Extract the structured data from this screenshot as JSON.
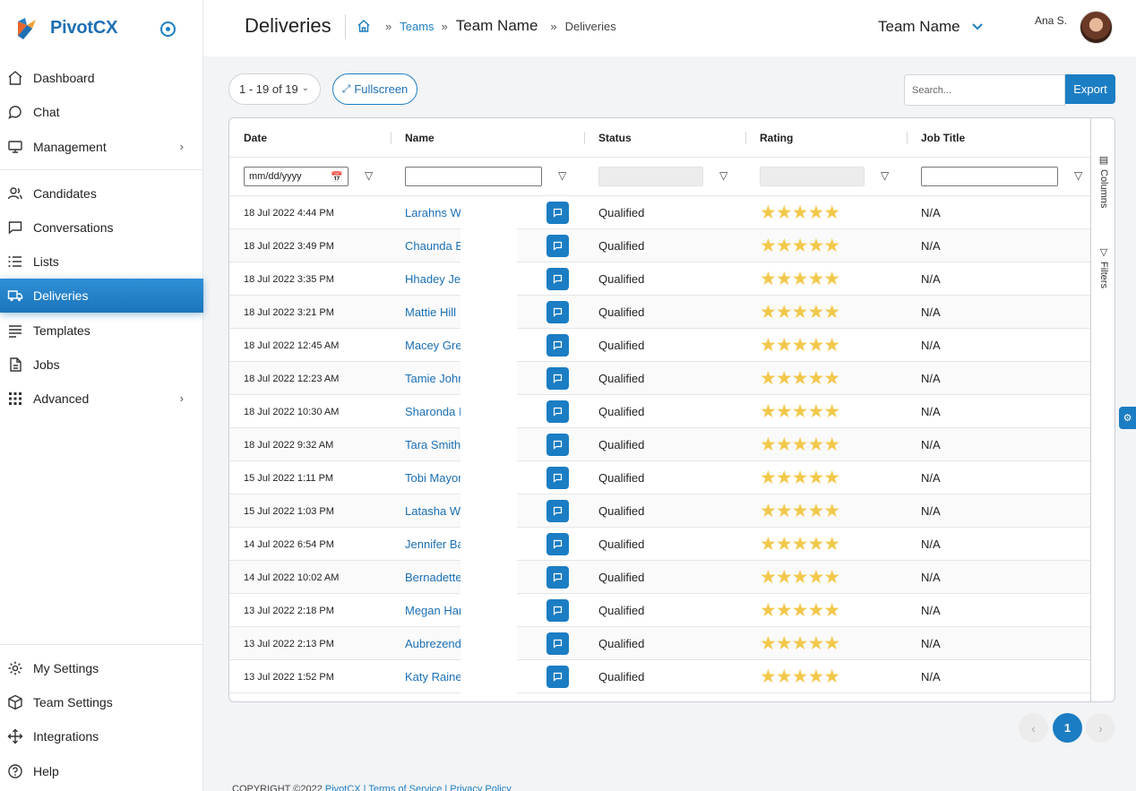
{
  "brand": {
    "name": "PivotCX"
  },
  "sidebar": {
    "main_items": [
      {
        "label": "Dashboard",
        "icon": "home-icon"
      },
      {
        "label": "Chat",
        "icon": "chat-bubble-icon"
      },
      {
        "label": "Management",
        "icon": "monitor-icon",
        "has_children": true
      }
    ],
    "work_items": [
      {
        "label": "Candidates",
        "icon": "users-icon"
      },
      {
        "label": "Conversations",
        "icon": "message-square-icon"
      },
      {
        "label": "Lists",
        "icon": "list-icon"
      },
      {
        "label": "Deliveries",
        "icon": "truck-icon",
        "active": true
      },
      {
        "label": "Templates",
        "icon": "align-left-icon"
      },
      {
        "label": "Jobs",
        "icon": "document-icon"
      },
      {
        "label": "Advanced",
        "icon": "grid-icon",
        "has_children": true
      }
    ],
    "bottom_items": [
      {
        "label": "My Settings",
        "icon": "gear-icon"
      },
      {
        "label": "Team Settings",
        "icon": "box-icon"
      },
      {
        "label": "Integrations",
        "icon": "move-icon"
      },
      {
        "label": "Help",
        "icon": "help-circle-icon"
      }
    ]
  },
  "header": {
    "title": "Deliveries",
    "breadcrumb": {
      "teams": "Teams",
      "team_name": "Team Name",
      "current": "Deliveries"
    },
    "team_select": "Team Name",
    "user_name": "Ana S."
  },
  "toolbar": {
    "pager_label": "1 - 19 of 19",
    "fullscreen_label": "Fullscreen",
    "search_placeholder": "Search...",
    "export_label": "Export"
  },
  "grid": {
    "columns": [
      "Date",
      "Name",
      "Status",
      "Rating",
      "Job Title"
    ],
    "date_filter_placeholder": "mm/dd/yyyy",
    "rows": [
      {
        "date": "18 Jul 2022 4:44 PM",
        "name": "Larahns W",
        "status": "Qualified",
        "rating": 5,
        "job_title": "N/A"
      },
      {
        "date": "18 Jul 2022 3:49 PM",
        "name": "Chaunda B",
        "status": "Qualified",
        "rating": 5,
        "job_title": "N/A"
      },
      {
        "date": "18 Jul 2022 3:35 PM",
        "name": "Hhadey Je",
        "status": "Qualified",
        "rating": 5,
        "job_title": "N/A"
      },
      {
        "date": "18 Jul 2022 3:21 PM",
        "name": "Mattie Hill",
        "status": "Qualified",
        "rating": 5,
        "job_title": "N/A"
      },
      {
        "date": "18 Jul 2022 12:45 AM",
        "name": "Macey Gre",
        "status": "Qualified",
        "rating": 5,
        "job_title": "N/A"
      },
      {
        "date": "18 Jul 2022 12:23 AM",
        "name": "Tamie Johr",
        "status": "Qualified",
        "rating": 5,
        "job_title": "N/A"
      },
      {
        "date": "18 Jul 2022 10:30 AM",
        "name": "Sharonda I",
        "status": "Qualified",
        "rating": 5,
        "job_title": "N/A"
      },
      {
        "date": "18 Jul 2022 9:32 AM",
        "name": "Tara Smith",
        "status": "Qualified",
        "rating": 5,
        "job_title": "N/A"
      },
      {
        "date": "15 Jul 2022 1:11 PM",
        "name": "Tobi Mayor",
        "status": "Qualified",
        "rating": 5,
        "job_title": "N/A"
      },
      {
        "date": "15 Jul 2022 1:03 PM",
        "name": "Latasha W",
        "status": "Qualified",
        "rating": 5,
        "job_title": "N/A"
      },
      {
        "date": "14 Jul 2022 6:54 PM",
        "name": "Jennifer Ba",
        "status": "Qualified",
        "rating": 5,
        "job_title": "N/A"
      },
      {
        "date": "14 Jul 2022 10:02 AM",
        "name": "Bernadette",
        "status": "Qualified",
        "rating": 5,
        "job_title": "N/A"
      },
      {
        "date": "13 Jul 2022 2:18 PM",
        "name": "Megan Har",
        "status": "Qualified",
        "rating": 5,
        "job_title": "N/A"
      },
      {
        "date": "13 Jul 2022 2:13 PM",
        "name": "Aubrezend",
        "status": "Qualified",
        "rating": 5,
        "job_title": "N/A"
      },
      {
        "date": "13 Jul 2022 1:52 PM",
        "name": "Katy Raine",
        "status": "Qualified",
        "rating": 5,
        "job_title": "N/A"
      }
    ],
    "side_tabs": {
      "columns": "Columns",
      "filters": "Filters"
    }
  },
  "pagination": {
    "current_page": "1",
    "prev": "‹",
    "next": "›"
  },
  "footer": {
    "text": "COPYRIGHT ©2022",
    "links": "PivotCX | Terms of Service | Privacy Policy"
  },
  "colors": {
    "accent": "#1b7dc3",
    "brand": "#1e6fb3",
    "star": "#f2c84b"
  }
}
